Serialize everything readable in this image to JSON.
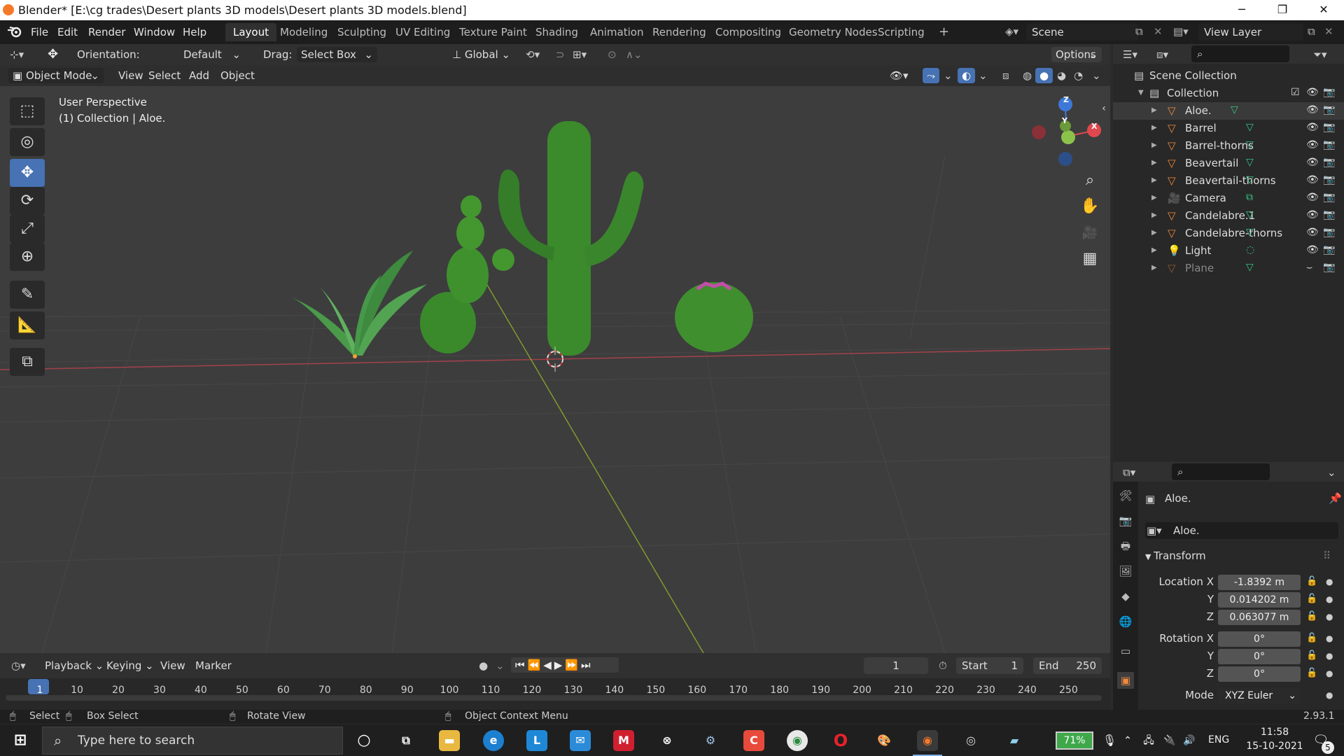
{
  "window": {
    "title": "Blender* [E:\\cg trades\\Desert plants 3D models\\Desert plants 3D models.blend]",
    "minimize": "─",
    "maximize": "❐",
    "close": "✕"
  },
  "menus": [
    "File",
    "Edit",
    "Render",
    "Window",
    "Help"
  ],
  "workspaces": [
    "Layout",
    "Modeling",
    "Sculpting",
    "UV Editing",
    "Texture Paint",
    "Shading",
    "Animation",
    "Rendering",
    "Compositing",
    "Geometry Nodes",
    "Scripting",
    "+"
  ],
  "active_workspace": "Layout",
  "scene": {
    "name": "Scene",
    "view_layer": "View Layer"
  },
  "tool_header": {
    "orientation_label": "Orientation:",
    "orientation_value": "Default",
    "drag_label": "Drag:",
    "drag_value": "Select Box",
    "transform_orientation": "Global",
    "options": "Options"
  },
  "viewport_header": {
    "mode": "Object Mode",
    "menus": [
      "View",
      "Select",
      "Add",
      "Object"
    ]
  },
  "viewport": {
    "perspective": "User Perspective",
    "collection_info": "(1) Collection | Aloe."
  },
  "gizmo": {
    "x": "X",
    "y": "Y",
    "z": "Z"
  },
  "outliner": {
    "root": "Scene Collection",
    "collection": "Collection",
    "items": [
      {
        "name": "Aloe.",
        "type": "mesh"
      },
      {
        "name": "Barrel",
        "type": "mesh"
      },
      {
        "name": "Barrel-thorns",
        "type": "mesh"
      },
      {
        "name": "Beavertail",
        "type": "mesh"
      },
      {
        "name": "Beavertail-thorns",
        "type": "mesh"
      },
      {
        "name": "Camera",
        "type": "camera"
      },
      {
        "name": "Candelabre.1",
        "type": "mesh"
      },
      {
        "name": "Candelabre-thorns",
        "type": "mesh"
      },
      {
        "name": "Light",
        "type": "light"
      },
      {
        "name": "Plane",
        "type": "mesh"
      }
    ]
  },
  "properties": {
    "object_name": "Aloe.",
    "data_name": "Aloe.",
    "panel": "Transform",
    "location_label": "Location X",
    "location": {
      "x": "-1.8392 m",
      "y": "0.014202 m",
      "z": "0.063077 m"
    },
    "rotation_label": "Rotation X",
    "rotation": {
      "x": "0°",
      "y": "0°",
      "z": "0°"
    },
    "axis_y": "Y",
    "axis_z": "Z",
    "mode_label": "Mode",
    "mode_value": "XYZ Euler"
  },
  "timeline": {
    "menus": [
      "Playback",
      "Keying",
      "View",
      "Marker"
    ],
    "current_frame": "1",
    "start_label": "Start",
    "start": "1",
    "end_label": "End",
    "end": "250",
    "ticks": [
      "1",
      "10",
      "20",
      "30",
      "40",
      "50",
      "60",
      "70",
      "80",
      "90",
      "100",
      "110",
      "120",
      "130",
      "140",
      "150",
      "160",
      "170",
      "180",
      "190",
      "200",
      "210",
      "220",
      "230",
      "240",
      "250"
    ]
  },
  "statusbar": {
    "select": "Select",
    "box_select": "Box Select",
    "rotate_view": "Rotate View",
    "context_menu": "Object Context Menu",
    "version": "2.93.1"
  },
  "taskbar": {
    "search_placeholder": "Type here to search",
    "battery": "71%",
    "language": "ENG",
    "time": "11:58",
    "date": "15-10-2021",
    "notifications": "5"
  },
  "colors": {
    "accent": "#4772b3",
    "active_tab": "#303030",
    "mesh_icon": "#f0893b",
    "data_icon": "#36c484",
    "x_axis": "#e04850",
    "y_axis": "#8bc34a",
    "z_axis": "#3d78d8",
    "cactus": "#3f8a28"
  }
}
